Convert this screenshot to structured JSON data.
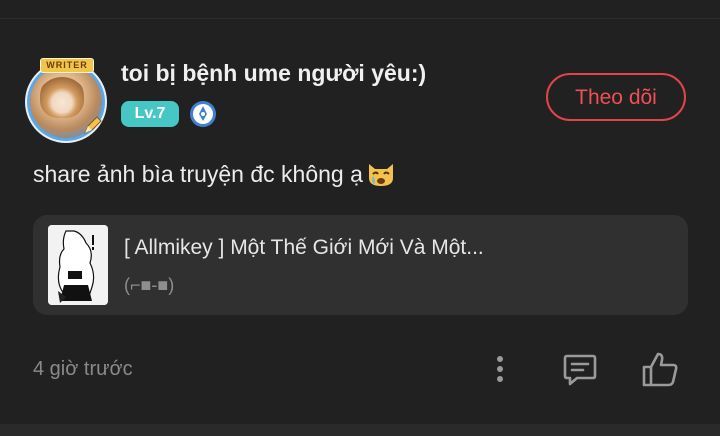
{
  "user": {
    "name": "toi bị bệnh ume người yêu:)",
    "level": "Lv.7",
    "avatar_banner": "WRITER"
  },
  "follow_button": {
    "label": "Theo dõi"
  },
  "post": {
    "text": "share ảnh bìa truyện đc không ạ",
    "emoji": "crying-cat-face"
  },
  "story": {
    "title": "[ Allmikey ] Một Thế Giới Mới Và Một...",
    "subtitle": "(⌐■-■)"
  },
  "footer": {
    "timestamp": "4 giờ trước"
  },
  "colors": {
    "background": "#212121",
    "accent_red": "#e2434c",
    "level_teal": "#46c6c4",
    "card": "#303030"
  },
  "icons": [
    "writer-avatar-icon",
    "writer-badge-icon",
    "more-vertical-icon",
    "comment-icon",
    "thumbs-up-icon"
  ]
}
